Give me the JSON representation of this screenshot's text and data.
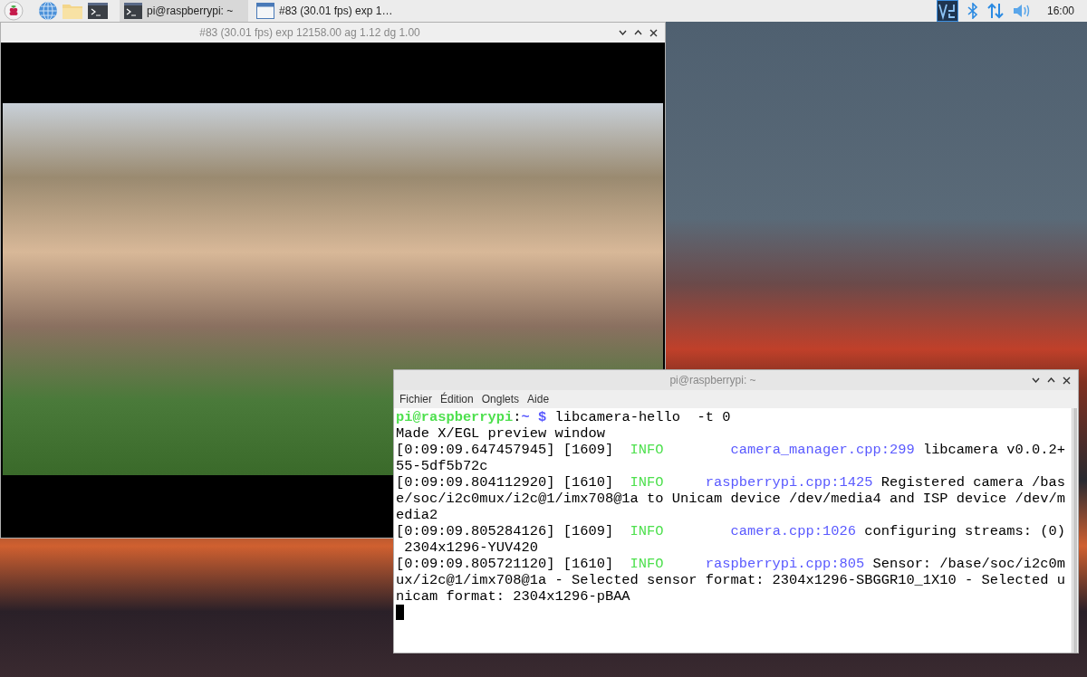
{
  "taskbar": {
    "tasks": [
      {
        "kind": "terminal",
        "label": "pi@raspberrypi: ~",
        "selected": true
      },
      {
        "kind": "window",
        "label": "#83 (30.01 fps) exp 1…",
        "selected": false
      }
    ],
    "clock": "16:00"
  },
  "preview_window": {
    "title": "#83 (30.01 fps) exp 12158.00 ag 1.12 dg 1.00"
  },
  "terminal_window": {
    "title": "pi@raspberrypi: ~",
    "menu": [
      "Fichier",
      "Édition",
      "Onglets",
      "Aide"
    ],
    "lines": [
      [
        {
          "kind": "user",
          "text": "pi@raspberrypi"
        },
        {
          "kind": "plain",
          "text": ":"
        },
        {
          "kind": "path",
          "text": "~ $"
        },
        {
          "kind": "plain",
          "text": " libcamera-hello  -t 0"
        }
      ],
      [
        {
          "kind": "plain",
          "text": "Made X/EGL preview window"
        }
      ],
      [
        {
          "kind": "plain",
          "text": "[0:09:09.647457945] [1609]  "
        },
        {
          "kind": "level",
          "text": "INFO        "
        },
        {
          "kind": "source",
          "text": "camera_manager.cpp:299"
        },
        {
          "kind": "plain",
          "text": " libcamera v0.0.2+"
        }
      ],
      [
        {
          "kind": "plain",
          "text": "55-5df5b72c"
        }
      ],
      [
        {
          "kind": "plain",
          "text": "[0:09:09.804112920] [1610]  "
        },
        {
          "kind": "level",
          "text": "INFO     "
        },
        {
          "kind": "source",
          "text": "raspberrypi.cpp:1425"
        },
        {
          "kind": "plain",
          "text": " Registered camera /bas"
        }
      ],
      [
        {
          "kind": "plain",
          "text": "e/soc/i2c0mux/i2c@1/imx708@1a to Unicam device /dev/media4 and ISP device /dev/m"
        }
      ],
      [
        {
          "kind": "plain",
          "text": "edia2"
        }
      ],
      [
        {
          "kind": "plain",
          "text": "[0:09:09.805284126] [1609]  "
        },
        {
          "kind": "level",
          "text": "INFO        "
        },
        {
          "kind": "source",
          "text": "camera.cpp:1026"
        },
        {
          "kind": "plain",
          "text": " configuring streams: (0)"
        }
      ],
      [
        {
          "kind": "plain",
          "text": " 2304x1296-YUV420"
        }
      ],
      [
        {
          "kind": "plain",
          "text": "[0:09:09.805721120] [1610]  "
        },
        {
          "kind": "level",
          "text": "INFO     "
        },
        {
          "kind": "source",
          "text": "raspberrypi.cpp:805"
        },
        {
          "kind": "plain",
          "text": " Sensor: /base/soc/i2c0m"
        }
      ],
      [
        {
          "kind": "plain",
          "text": "ux/i2c@1/imx708@1a - Selected sensor format: 2304x1296-SBGGR10_1X10 - Selected u"
        }
      ],
      [
        {
          "kind": "plain",
          "text": "nicam format: 2304x1296-pBAA"
        }
      ]
    ]
  }
}
